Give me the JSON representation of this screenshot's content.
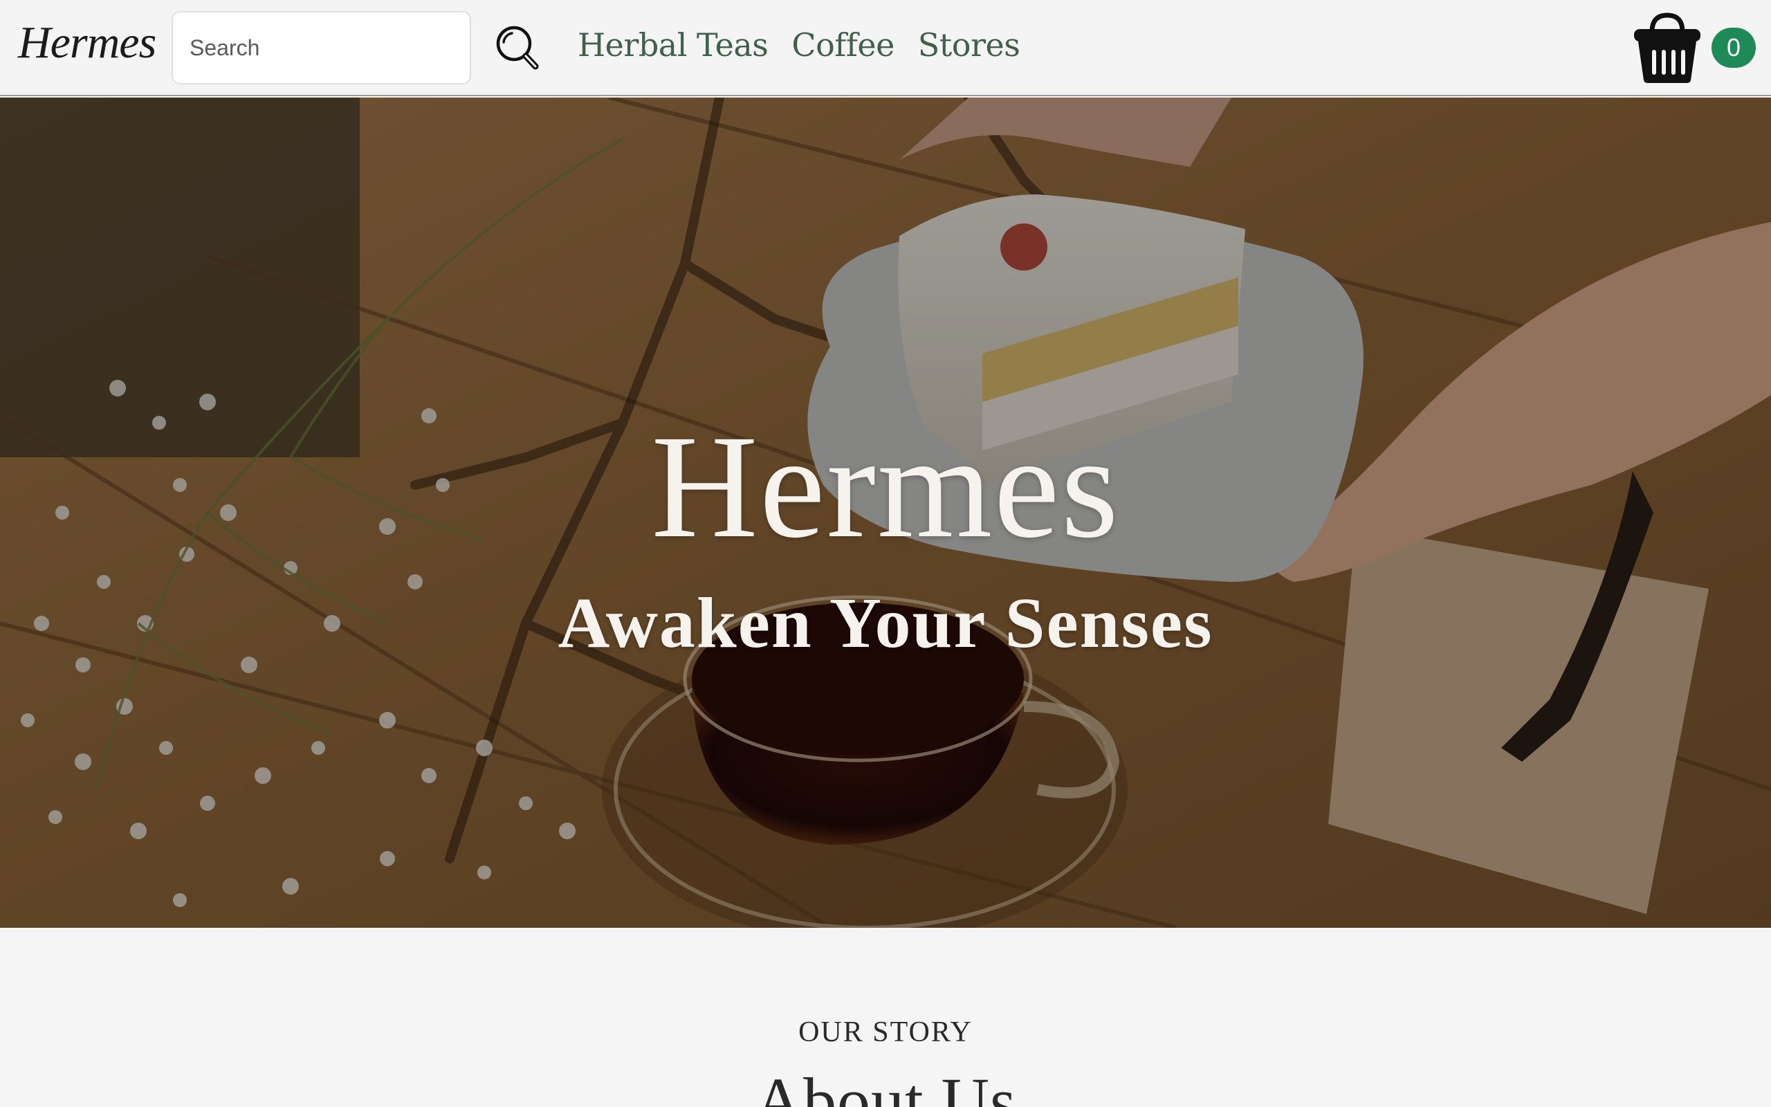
{
  "header": {
    "logo": "Hermes",
    "search": {
      "placeholder": "Search",
      "value": ""
    },
    "nav": [
      "Herbal Teas",
      "Coffee",
      "Stores"
    ],
    "cart_count": "0"
  },
  "hero": {
    "title": "Hermes",
    "subtitle": "Awaken Your Senses"
  },
  "story": {
    "eyebrow": "OUR STORY",
    "title": "About Us"
  },
  "colors": {
    "nav_link": "#40604a",
    "cart_badge": "#1e8a57",
    "background": "#f5f5f5",
    "table_wood": "#9b6e40"
  },
  "icons": [
    "search-icon",
    "shopping-basket-icon"
  ]
}
